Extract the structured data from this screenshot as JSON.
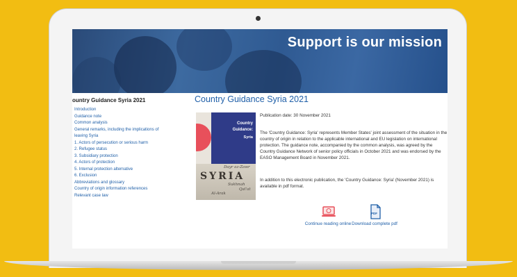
{
  "hero": {
    "title": "Support is our mission"
  },
  "sidebar": {
    "title": "ountry Guidance Syria 2021",
    "items": [
      "Introduction",
      "Guidance note",
      "Common analysis",
      "General remarks, including the implications of",
      "leaving Syria",
      "1. Actors of persecution or serious harm",
      "2. Refugee status",
      "3. Subsidiary protection",
      "4. Actors of protection",
      "5. Internal protection alternative",
      "6. Exclusion",
      "Abbreviations and glossary",
      "Country of origin information references",
      "Relevant case law"
    ]
  },
  "main": {
    "title": "Country Guidance Syria 2021",
    "publication_date": "Publication date: 30 November 2021",
    "paragraph1": "The 'Country Guidance: Syria' represents Member States' joint assessment of the situation in the country of origin in relation to the applicable international and EU legislation on international protection. The guidance note, accompanied by the common analysis, was agreed by the Country Guidance Network of senior policy officials in October 2021 and was endorsed by the EASO Management Board in November 2021.",
    "paragraph2": "In addition to this electronic publication, the 'Country Guidance: Syria' (November 2021) is available in pdf format.",
    "cover": {
      "line1": "Country",
      "line2": "Guidance:",
      "line3": "Syria",
      "country": "SYRIA",
      "map_labels": [
        "Dayr az-Zawr",
        "Sukhnah",
        "Qal'at",
        "Al-Arak"
      ]
    },
    "actions": {
      "read_online": "Continue reading online",
      "download_pdf": "Download complete pdf",
      "pdf_badge": "PDF"
    }
  },
  "colors": {
    "background": "#f2bd12",
    "link": "#1f5fa8",
    "hero": "#2f5a92"
  }
}
